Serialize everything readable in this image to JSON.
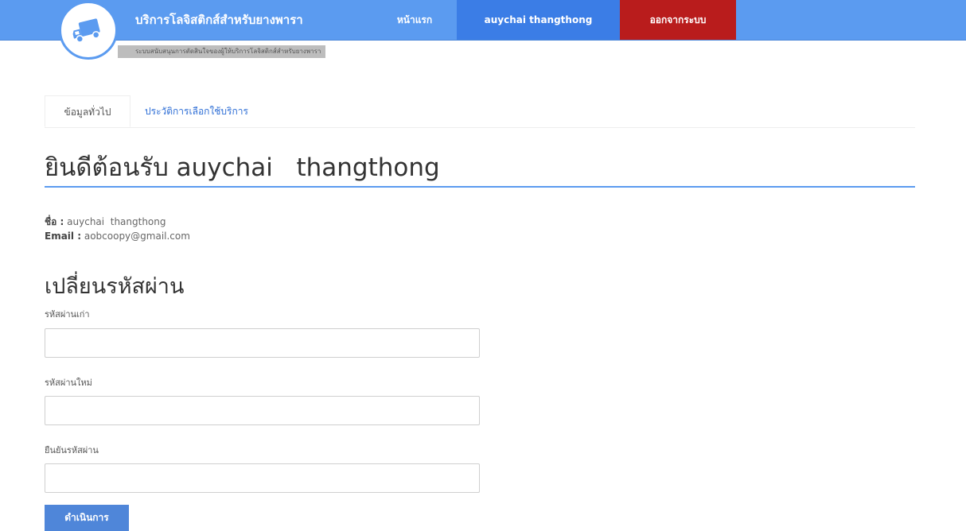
{
  "header": {
    "brand_title": "บริการโลจิสติกส์สำหรับยางพารา",
    "brand_subtitle": "ระบบสนับสนุนการตัดสินใจของผู้ให้บริการโลจิสติกส์สำหรับยางพารา",
    "logo_icon": "truck-icon",
    "nav": {
      "home": "หน้าแรก",
      "user": "auychai  thangthong",
      "logout": "ออกจากระบบ"
    },
    "colors": {
      "bar": "#5b9bf0",
      "user_active": "#3b7de6",
      "logout": "#b91c1c"
    }
  },
  "tabs": {
    "general": "ข้อมูลทั่วไป",
    "history": "ประวัติการเลือกใช้บริการ"
  },
  "profile": {
    "welcome": "ยินดีต้อนรับ auychai   thangthong",
    "name_label": "ชื่อ :",
    "name_value": "auychai  thangthong",
    "email_label": "Email :",
    "email_value": "aobcoopy@gmail.com"
  },
  "password_form": {
    "title": "เปลี่ยนรหัสผ่าน",
    "old_label": "รหัสผ่านเก่า",
    "old_value": "",
    "new_label": "รหัสผ่านใหม่",
    "new_value": "",
    "confirm_label": "ยืนยันรหัสผ่าน",
    "confirm_value": "",
    "submit": "ดำเนินการ"
  }
}
